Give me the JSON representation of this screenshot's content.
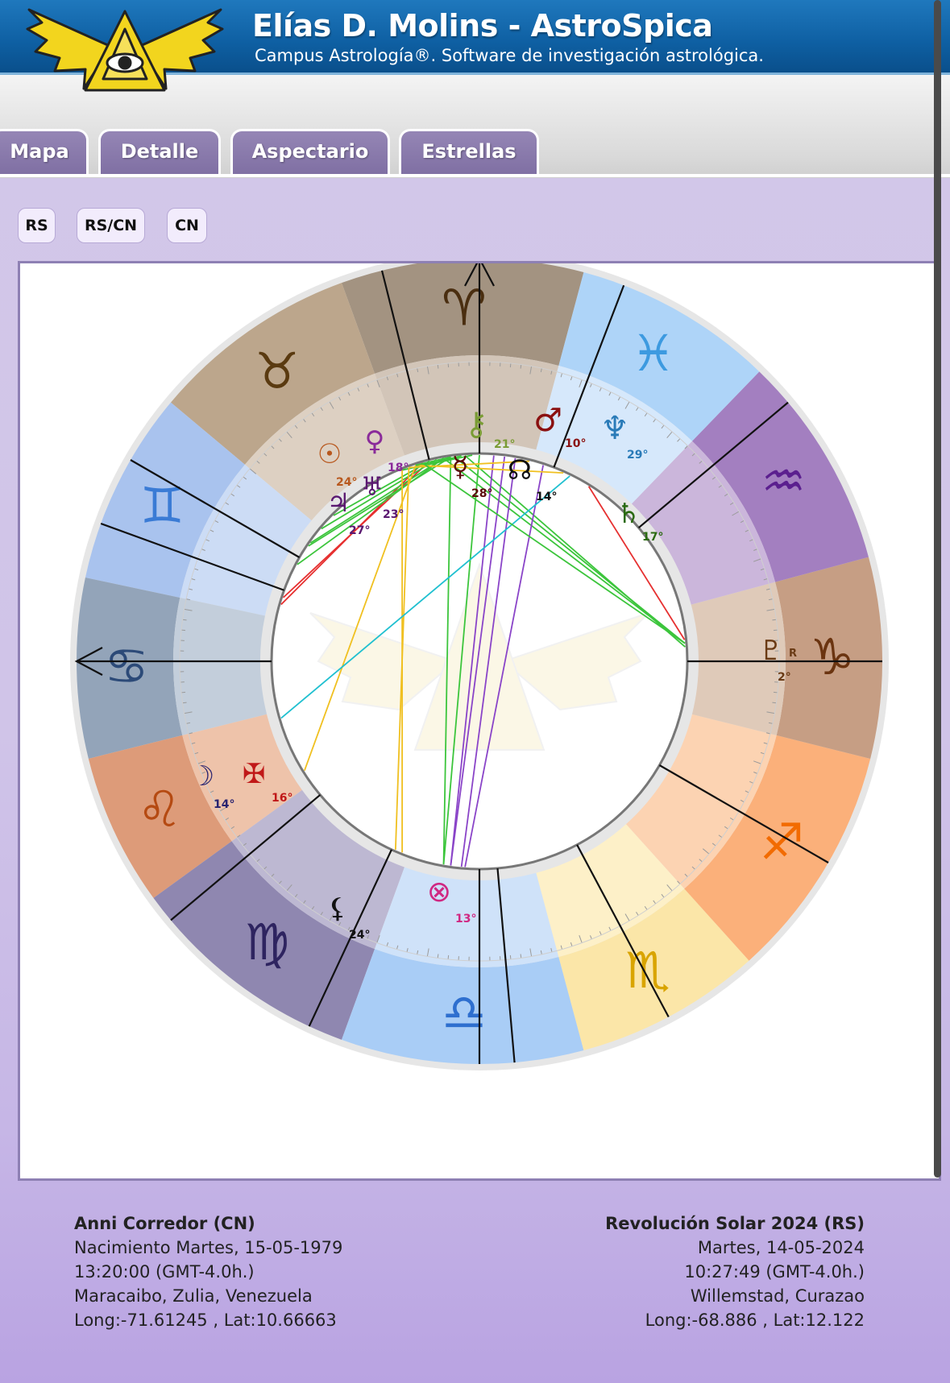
{
  "header": {
    "title": "Elías D. Molins - AstroSpica",
    "subtitle": "Campus Astrología®. Software de investigación astrológica.",
    "logo_icon": "winged-eye-triangle-icon"
  },
  "tabs": [
    {
      "label": "Mapa"
    },
    {
      "label": "Detalle"
    },
    {
      "label": "Aspectario"
    },
    {
      "label": "Estrellas"
    }
  ],
  "chart_modes": [
    {
      "label": "RS"
    },
    {
      "label": "RS/CN"
    },
    {
      "label": "CN"
    }
  ],
  "chart": {
    "sign_icons": [
      "aries-icon",
      "taurus-icon",
      "gemini-icon",
      "cancer-icon",
      "leo-icon",
      "virgo-icon",
      "libra-icon",
      "scorpio-icon",
      "sagittarius-icon",
      "capricorn-icon",
      "aquarius-icon",
      "pisces-icon"
    ],
    "planets": [
      {
        "name": "chiron",
        "symbol": "⚷",
        "degree": "21°"
      },
      {
        "name": "mars",
        "symbol": "♂",
        "degree": "10°"
      },
      {
        "name": "neptune",
        "symbol": "♆",
        "degree": "29°"
      },
      {
        "name": "venus",
        "symbol": "♀",
        "degree": "18°"
      },
      {
        "name": "sun",
        "symbol": "☉",
        "degree": "24°"
      },
      {
        "name": "uranus",
        "symbol": "♅",
        "degree": "23°"
      },
      {
        "name": "jupiter",
        "symbol": "♃",
        "degree": "27°"
      },
      {
        "name": "mercury",
        "symbol": "☿",
        "degree": "28°"
      },
      {
        "name": "node",
        "symbol": "☊",
        "degree": "14°"
      },
      {
        "name": "saturn",
        "symbol": "♄",
        "degree": "17°"
      },
      {
        "name": "pluto",
        "symbol": "♇",
        "degree": "2°",
        "retro": "R"
      },
      {
        "name": "moon",
        "symbol": "☽",
        "degree": "14°"
      },
      {
        "name": "part-of-fortune",
        "symbol": "⊗",
        "degree": "13°"
      },
      {
        "name": "lilith",
        "symbol": "⚸",
        "degree": "24°"
      },
      {
        "name": "vertex",
        "symbol": "✠",
        "degree": "16°"
      }
    ]
  },
  "natal_info": {
    "name": "Anni Corredor (CN)",
    "date": "Nacimiento Martes, 15-05-1979",
    "time": "13:20:00 (GMT-4.0h.)",
    "place": "Maracaibo, Zulia, Venezuela",
    "coords": "Long:-71.61245 , Lat:10.66663"
  },
  "return_info": {
    "name": "Revolución Solar 2024 (RS)",
    "date": "Martes, 14-05-2024",
    "time": "10:27:49 (GMT-4.0h.)",
    "place": "Willemstad, Curazao",
    "coords": "Long:-68.886 , Lat:12.122"
  }
}
